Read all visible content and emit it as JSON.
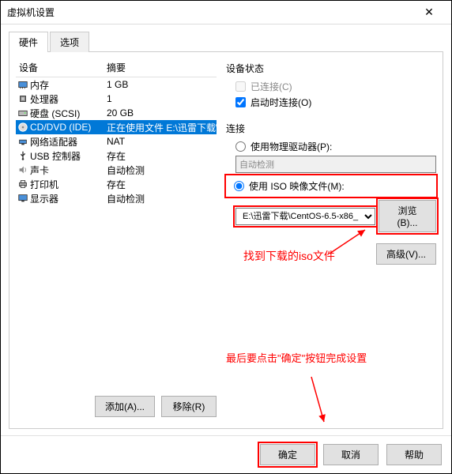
{
  "title": "虚拟机设置",
  "tabs": {
    "hardware": "硬件",
    "options": "选项"
  },
  "headers": {
    "device": "设备",
    "summary": "摘要"
  },
  "devices": [
    {
      "icon": "memory",
      "name": "内存",
      "summary": "1 GB",
      "selected": false
    },
    {
      "icon": "cpu",
      "name": "处理器",
      "summary": "1",
      "selected": false
    },
    {
      "icon": "disk",
      "name": "硬盘 (SCSI)",
      "summary": "20 GB",
      "selected": false
    },
    {
      "icon": "cd",
      "name": "CD/DVD (IDE)",
      "summary": "正在使用文件 E:\\迅雷下载\\C...",
      "selected": true
    },
    {
      "icon": "net",
      "name": "网络适配器",
      "summary": "NAT",
      "selected": false
    },
    {
      "icon": "usb",
      "name": "USB 控制器",
      "summary": "存在",
      "selected": false
    },
    {
      "icon": "sound",
      "name": "声卡",
      "summary": "自动检测",
      "selected": false
    },
    {
      "icon": "printer",
      "name": "打印机",
      "summary": "存在",
      "selected": false
    },
    {
      "icon": "display",
      "name": "显示器",
      "summary": "自动检测",
      "selected": false
    }
  ],
  "left_buttons": {
    "add": "添加(A)...",
    "remove": "移除(R)"
  },
  "status": {
    "label": "设备状态",
    "connected": "已连接(C)",
    "connect_poweron": "启动时连接(O)"
  },
  "connect": {
    "label": "连接",
    "physical": "使用物理驱动器(P):",
    "physical_value": "自动检测",
    "iso": "使用 ISO 映像文件(M):",
    "iso_value": "E:\\迅雷下载\\CentOS-6.5-x86_",
    "browse": "浏览(B)..."
  },
  "advanced": "高级(V)...",
  "annotations": {
    "find_iso": "找到下载的iso文件",
    "click_ok": "最后要点击\"确定\"按钮完成设置"
  },
  "footer": {
    "ok": "确定",
    "cancel": "取消",
    "help": "帮助"
  }
}
